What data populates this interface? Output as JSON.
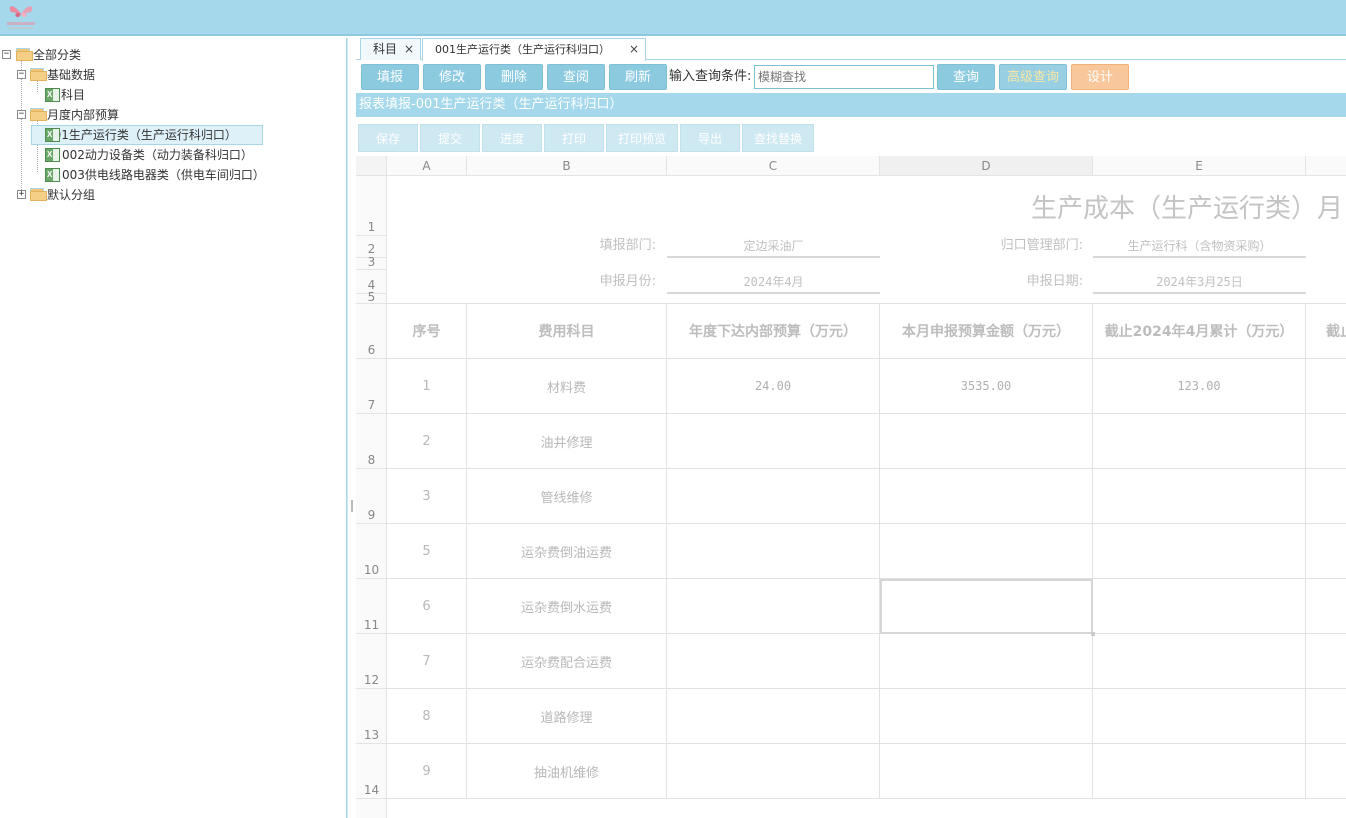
{
  "logo": {
    "alt": "logo"
  },
  "tree": {
    "root": "全部分类",
    "groups": [
      {
        "label": "基础数据",
        "items": [
          "科目"
        ]
      },
      {
        "label": "月度内部预算",
        "items": [
          "001生产运行类（生产运行科归口）",
          "002动力设备类（动力装备科归口）",
          "003供电线路电器类（供电车间归口）"
        ]
      },
      {
        "label": "默认分组",
        "items": []
      }
    ]
  },
  "tabs": [
    {
      "label": "科目"
    },
    {
      "label": "001生产运行类（生产运行科归口）"
    }
  ],
  "toolbar": {
    "fill": "填报",
    "edit": "修改",
    "delete": "删除",
    "view": "查阅",
    "refresh": "刷新",
    "query_label": "输入查询条件:",
    "query_placeholder": "模糊查找",
    "query": "查询",
    "advanced_query": "高级查询",
    "design": "设计"
  },
  "report_title": "报表填报-001生产运行类（生产运行科归口）",
  "report_toolbar": {
    "save": "保存",
    "submit": "提交",
    "progress": "进度",
    "print": "打印",
    "print_preview": "打印预览",
    "export": "导出",
    "find_replace": "查找替换"
  },
  "sheet": {
    "columns": [
      "A",
      "B",
      "C",
      "D",
      "E"
    ],
    "rows": [
      "1",
      "2",
      "3",
      "4",
      "5",
      "6",
      "7",
      "8",
      "9",
      "10",
      "11",
      "12",
      "13",
      "14"
    ],
    "title": "生产成本（生产运行类）月",
    "fill_dept_label": "填报部门:",
    "fill_dept_value": "定边采油厂",
    "mgmt_dept_label": "归口管理部门:",
    "mgmt_dept_value": "生产运行科（含物资采购）",
    "month_label": "申报月份:",
    "month_value": "2024年4月",
    "date_label": "申报日期:",
    "date_value": "2024年3月25日",
    "headers": [
      "序号",
      "费用科目",
      "年度下达内部预算（万元）",
      "本月申报预算金额（万元）",
      "截止2024年4月累计（万元）",
      "截止"
    ],
    "data_rows": [
      {
        "no": "1",
        "item": "材料费",
        "c": "24.00",
        "d": "3535.00",
        "e": "123.00"
      },
      {
        "no": "2",
        "item": "油井修理",
        "c": "",
        "d": "",
        "e": ""
      },
      {
        "no": "3",
        "item": "管线维修",
        "c": "",
        "d": "",
        "e": ""
      },
      {
        "no": "5",
        "item": "运杂费倒油运费",
        "c": "",
        "d": "",
        "e": ""
      },
      {
        "no": "6",
        "item": "运杂费倒水运费",
        "c": "",
        "d": "",
        "e": ""
      },
      {
        "no": "7",
        "item": "运杂费配合运费",
        "c": "",
        "d": "",
        "e": ""
      },
      {
        "no": "8",
        "item": "道路修理",
        "c": "",
        "d": "",
        "e": ""
      },
      {
        "no": "9",
        "item": "抽油机维修",
        "c": "",
        "d": "",
        "e": ""
      }
    ]
  }
}
